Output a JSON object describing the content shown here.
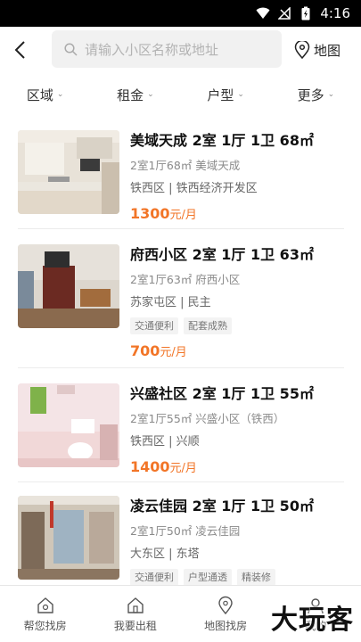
{
  "status": {
    "time": "4:16"
  },
  "search": {
    "placeholder": "请输入小区名称或地址",
    "map_label": "地图"
  },
  "filters": [
    "区域",
    "租金",
    "户型",
    "更多"
  ],
  "listings": [
    {
      "title": "美域天成 2室 1厅 1卫 68㎡",
      "sub": "2室1厅68㎡ 美域天成",
      "area": "铁西区 | 铁西经济开发区",
      "tags": [],
      "price": "1300",
      "unit": "元/月"
    },
    {
      "title": "府西小区 2室 1厅 1卫 63㎡",
      "sub": "2室1厅63㎡ 府西小区",
      "area": "苏家屯区 | 民主",
      "tags": [
        "交通便利",
        "配套成熟"
      ],
      "price": "700",
      "unit": "元/月"
    },
    {
      "title": "兴盛社区 2室 1厅 1卫 55㎡",
      "sub": "2室1厅55㎡ 兴盛小区（铁西）",
      "area": "铁西区 | 兴顺",
      "tags": [],
      "price": "1400",
      "unit": "元/月"
    },
    {
      "title": "凌云佳园 2室 1厅 1卫 50㎡",
      "sub": "2室1厅50㎡ 凌云佳园",
      "area": "大东区 | 东塔",
      "tags": [
        "交通便利",
        "户型通透",
        "精装修"
      ],
      "price": "",
      "unit": ""
    }
  ],
  "bottom_nav": [
    "帮您找房",
    "我要出租",
    "地图找房",
    "我的"
  ],
  "watermark": "大玩客"
}
